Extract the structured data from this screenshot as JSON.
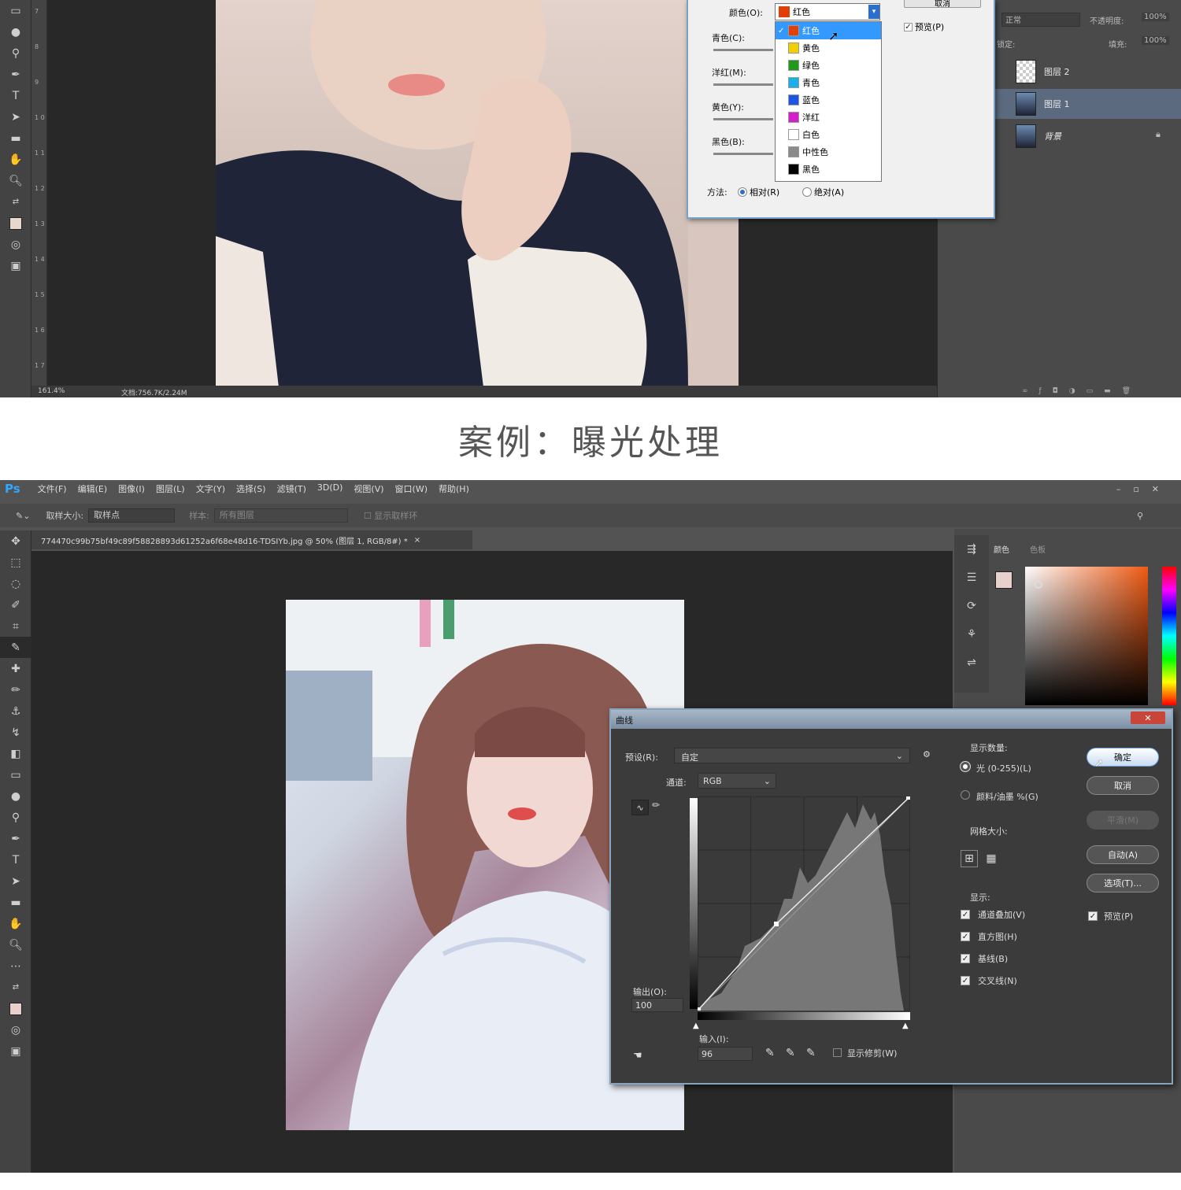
{
  "top_screen": {
    "status_zoom": "161.4%",
    "status_doc": "文档:756.7K/2.24M",
    "hue_dialog": {
      "cancel_label": "取消",
      "colors_label": "颜色(O):",
      "colors_value": "红色",
      "preview_label": "预览(P)",
      "cyan_label": "青色(C):",
      "magenta_label": "洋红(M):",
      "yellow_label": "黄色(Y):",
      "black_label": "黑色(B):",
      "method_label": "方法:",
      "relative_label": "相对(R)",
      "absolute_label": "绝对(A)",
      "dropdown": [
        {
          "label": "红色",
          "color": "#e2400a"
        },
        {
          "label": "黄色",
          "color": "#f0d000"
        },
        {
          "label": "绿色",
          "color": "#1f9a1f"
        },
        {
          "label": "青色",
          "color": "#18b0e8"
        },
        {
          "label": "蓝色",
          "color": "#1d56e0"
        },
        {
          "label": "洋红",
          "color": "#d21fc8"
        },
        {
          "label": "白色",
          "color": "#ffffff"
        },
        {
          "label": "中性色",
          "color": "#8a8a8a"
        },
        {
          "label": "黑色",
          "color": "#000000"
        }
      ]
    },
    "layers_panel": {
      "blend_mode": "正常",
      "opacity_label": "不透明度:",
      "opacity_value": "100%",
      "lock_label": "锁定:",
      "fill_label": "填充:",
      "fill_value": "100%",
      "layers": [
        "图层 2",
        "图层 1",
        "背景"
      ]
    }
  },
  "heading": "案例：曝光处理",
  "bottom_screen": {
    "ps_logo": "Ps",
    "menu": [
      "文件(F)",
      "编辑(E)",
      "图像(I)",
      "图层(L)",
      "文字(Y)",
      "选择(S)",
      "滤镜(T)",
      "3D(D)",
      "视图(V)",
      "窗口(W)",
      "帮助(H)"
    ],
    "options": {
      "sample_size_label": "取样大小:",
      "sample_size_value": "取样点",
      "sample_label": "样本:",
      "sample_value": "所有图层",
      "show_ring_label": "显示取样环"
    },
    "doc_tab": "774470c99b75bf49c89f58828893d61252a6f68e48d16-TDSIYb.jpg @ 50% (图层 1, RGB/8#) *",
    "color_panel_tabs": [
      "颜色",
      "色板"
    ],
    "curves": {
      "title": "曲线",
      "preset_label": "预设(R):",
      "preset_value": "自定",
      "channel_label": "通道:",
      "channel_value": "RGB",
      "output_label": "输出(O):",
      "output_value": "100",
      "input_label": "输入(I):",
      "input_value": "96",
      "show_clipping": "显示修剪(W)",
      "display_amount": "显示数量:",
      "light_option": "光 (0-255)(L)",
      "pigment_option": "颜料/油墨 %(G)",
      "grid_size": "网格大小:",
      "show_label": "显示:",
      "show_options": [
        "通道叠加(V)",
        "直方图(H)",
        "基线(B)",
        "交叉线(N)"
      ],
      "ok": "确定",
      "cancel": "取消",
      "smooth": "平滑(M)",
      "auto": "自动(A)",
      "options_btn": "选项(T)...",
      "preview": "预览(P)"
    }
  }
}
